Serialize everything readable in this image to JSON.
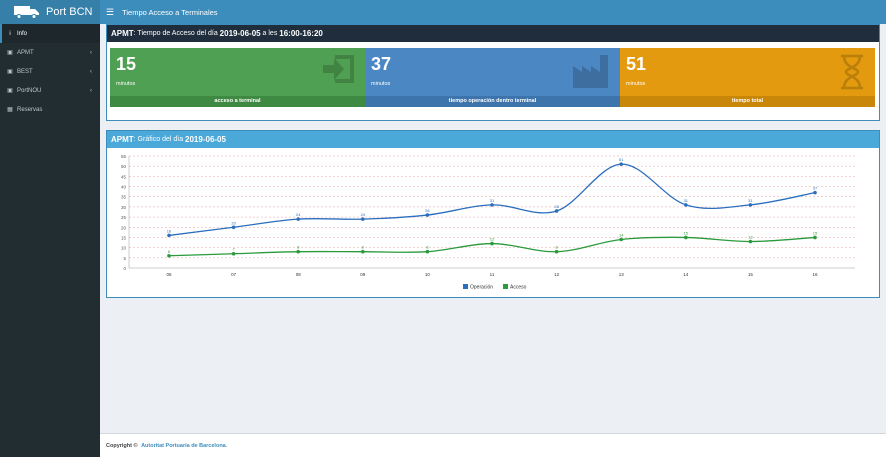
{
  "app": {
    "name": "Port BCN",
    "page_title": "Tiempo Acceso a Terminales"
  },
  "sidebar": {
    "items": [
      {
        "label": "Info",
        "icon": "info-icon",
        "active": true,
        "chevron": false
      },
      {
        "label": "APMT",
        "icon": "truck-icon",
        "active": false,
        "chevron": true
      },
      {
        "label": "BEST",
        "icon": "truck-icon",
        "active": false,
        "chevron": true
      },
      {
        "label": "PortNOU",
        "icon": "truck-icon",
        "active": false,
        "chevron": true
      },
      {
        "label": "Reservas",
        "icon": "calendar-icon",
        "active": false,
        "chevron": false
      }
    ]
  },
  "summary": {
    "terminal": "APMT",
    "header_text": ": Tiempo de Acceso del día ",
    "date": "2019-06-05",
    "between": " a les ",
    "time_range": "16:00-16:20",
    "tiles": [
      {
        "value": "15",
        "unit": "minutos",
        "label": "acceso a terminal",
        "color": "#4fa052",
        "footer": "#3f8a42",
        "icon": "sign-in-icon"
      },
      {
        "value": "37",
        "unit": "minutos",
        "label": "tiempo operación dentro terminal",
        "color": "#4b87c3",
        "footer": "#3d74ab",
        "icon": "factory-icon"
      },
      {
        "value": "51",
        "unit": "minutos",
        "label": "tiempo total",
        "color": "#e39a0e",
        "footer": "#c9870a",
        "icon": "hourglass-icon"
      }
    ]
  },
  "chart_box": {
    "terminal": "APMT",
    "header_text": ": Gráfico del día ",
    "date": "2019-06-05"
  },
  "chart_data": {
    "type": "line",
    "categories": [
      "06",
      "07",
      "08",
      "09",
      "10",
      "11",
      "12",
      "13",
      "14",
      "15",
      "16"
    ],
    "series": [
      {
        "name": "Operación",
        "color": "#2a6ebd",
        "values": [
          16,
          20,
          24,
          24,
          26,
          31,
          28,
          51,
          31,
          31,
          37
        ]
      },
      {
        "name": "Acceso",
        "color": "#2a9a3c",
        "values": [
          6,
          7,
          8,
          8,
          8,
          12,
          8,
          14,
          15,
          13,
          15
        ]
      }
    ],
    "ylim": [
      0,
      55
    ],
    "yticks": [
      0,
      5,
      10,
      15,
      20,
      25,
      30,
      35,
      40,
      45,
      50,
      55
    ],
    "grid": true,
    "legend": "bottom"
  },
  "footer": {
    "copyright": "Copyright © ",
    "org": "Autoritat Portuaria de Barcelona",
    "end": "."
  }
}
